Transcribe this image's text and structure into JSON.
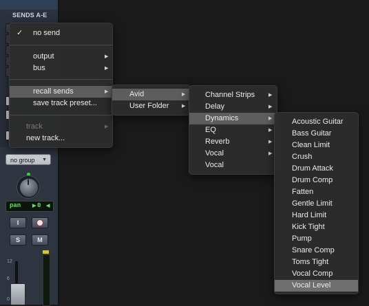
{
  "strip": {
    "sends_label": "SENDS A-E",
    "group_select": "no group",
    "pan_label": "pan",
    "pan_value": "0",
    "input_button": "I",
    "solo_button": "S",
    "mute_button": "M",
    "scale_12": "12",
    "scale_6": "6",
    "scale_0": "0"
  },
  "menu1": {
    "items": [
      {
        "label": "no send",
        "checked": true
      },
      {
        "label": "output"
      },
      {
        "label": "bus"
      },
      {
        "label": "recall sends"
      },
      {
        "label": "save track preset..."
      },
      {
        "label": "track",
        "disabled": true
      },
      {
        "label": "new track..."
      }
    ]
  },
  "menu2": {
    "items": [
      {
        "label": "Avid"
      },
      {
        "label": "User Folder"
      }
    ]
  },
  "menu3": {
    "items": [
      {
        "label": "Channel Strips"
      },
      {
        "label": "Delay"
      },
      {
        "label": "Dynamics"
      },
      {
        "label": "EQ"
      },
      {
        "label": "Reverb"
      },
      {
        "label": "Vocal"
      },
      {
        "label": "Vocal"
      }
    ]
  },
  "menu4": {
    "items": [
      {
        "label": "Acoustic Guitar"
      },
      {
        "label": "Bass Guitar"
      },
      {
        "label": "Clean Limit"
      },
      {
        "label": "Crush"
      },
      {
        "label": "Drum Attack"
      },
      {
        "label": "Drum Comp"
      },
      {
        "label": "Fatten"
      },
      {
        "label": "Gentle Limit"
      },
      {
        "label": "Hard Limit"
      },
      {
        "label": "Kick Tight"
      },
      {
        "label": "Pump"
      },
      {
        "label": "Snare Comp"
      },
      {
        "label": "Toms Tight"
      },
      {
        "label": "Vocal Comp"
      },
      {
        "label": "Vocal Level",
        "selected": true
      }
    ]
  },
  "colors": {
    "highlight": "#5d5d5d",
    "selected": "#6e6e6e",
    "menu_bg": "#2c2c2c",
    "pan_text": "#5ee65e"
  }
}
